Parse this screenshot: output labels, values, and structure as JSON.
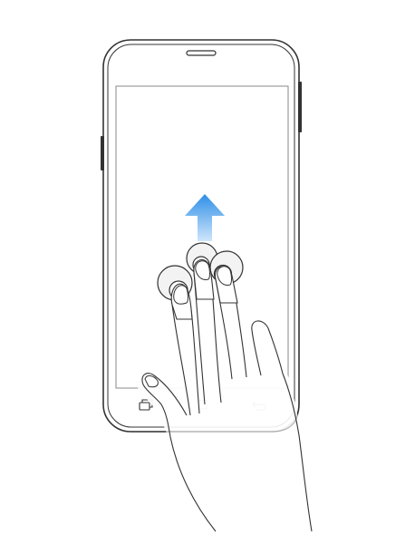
{
  "illustration": {
    "subject": "three-finger-swipe-up-gesture",
    "device": "smartphone",
    "gesture_direction": "up",
    "finger_count": 3
  },
  "phone": {
    "nav_bar": {
      "buttons": [
        {
          "icon": "recent-apps-icon"
        },
        {
          "icon": "home-icon"
        },
        {
          "icon": "back-icon"
        }
      ]
    }
  },
  "colors": {
    "outline": "#333333",
    "screen_border": "#8a8a8a",
    "arrow_top": "#2f8fe8",
    "arrow_bottom": "#cfe6fb",
    "touch_ring_fill": "#f3f3f3",
    "background": "#ffffff"
  }
}
